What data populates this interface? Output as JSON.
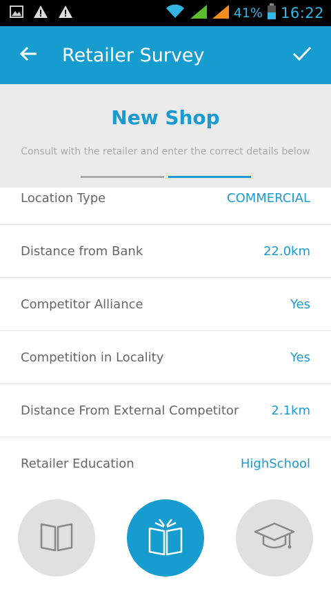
{
  "status_bar": {
    "battery": "41%",
    "time": "16:22"
  },
  "app_bar": {
    "title": "Retailer Survey"
  },
  "header": {
    "title": "New Shop",
    "subtitle": "Consult with the retailer and enter the correct details below",
    "progress": {
      "steps": 2,
      "current_step": 2
    }
  },
  "rows": [
    {
      "label": "Location Type",
      "value": "COMMERCIAL"
    },
    {
      "label": "Distance from Bank",
      "value": "22.0km"
    },
    {
      "label": "Competitor Alliance",
      "value": "Yes"
    },
    {
      "label": "Competition in Locality",
      "value": "Yes"
    },
    {
      "label": "Distance From External Competitor",
      "value": "2.1km"
    },
    {
      "label": "Retailer Education",
      "value": "HighSchool"
    }
  ],
  "education_options": [
    {
      "icon": "book-icon",
      "selected": false
    },
    {
      "icon": "open-book-icon",
      "selected": true
    },
    {
      "icon": "graduation-cap-icon",
      "selected": false
    }
  ],
  "colors": {
    "accent": "#169ccf",
    "accent_text": "#1a9ad1",
    "status_text": "#33b5e5"
  }
}
